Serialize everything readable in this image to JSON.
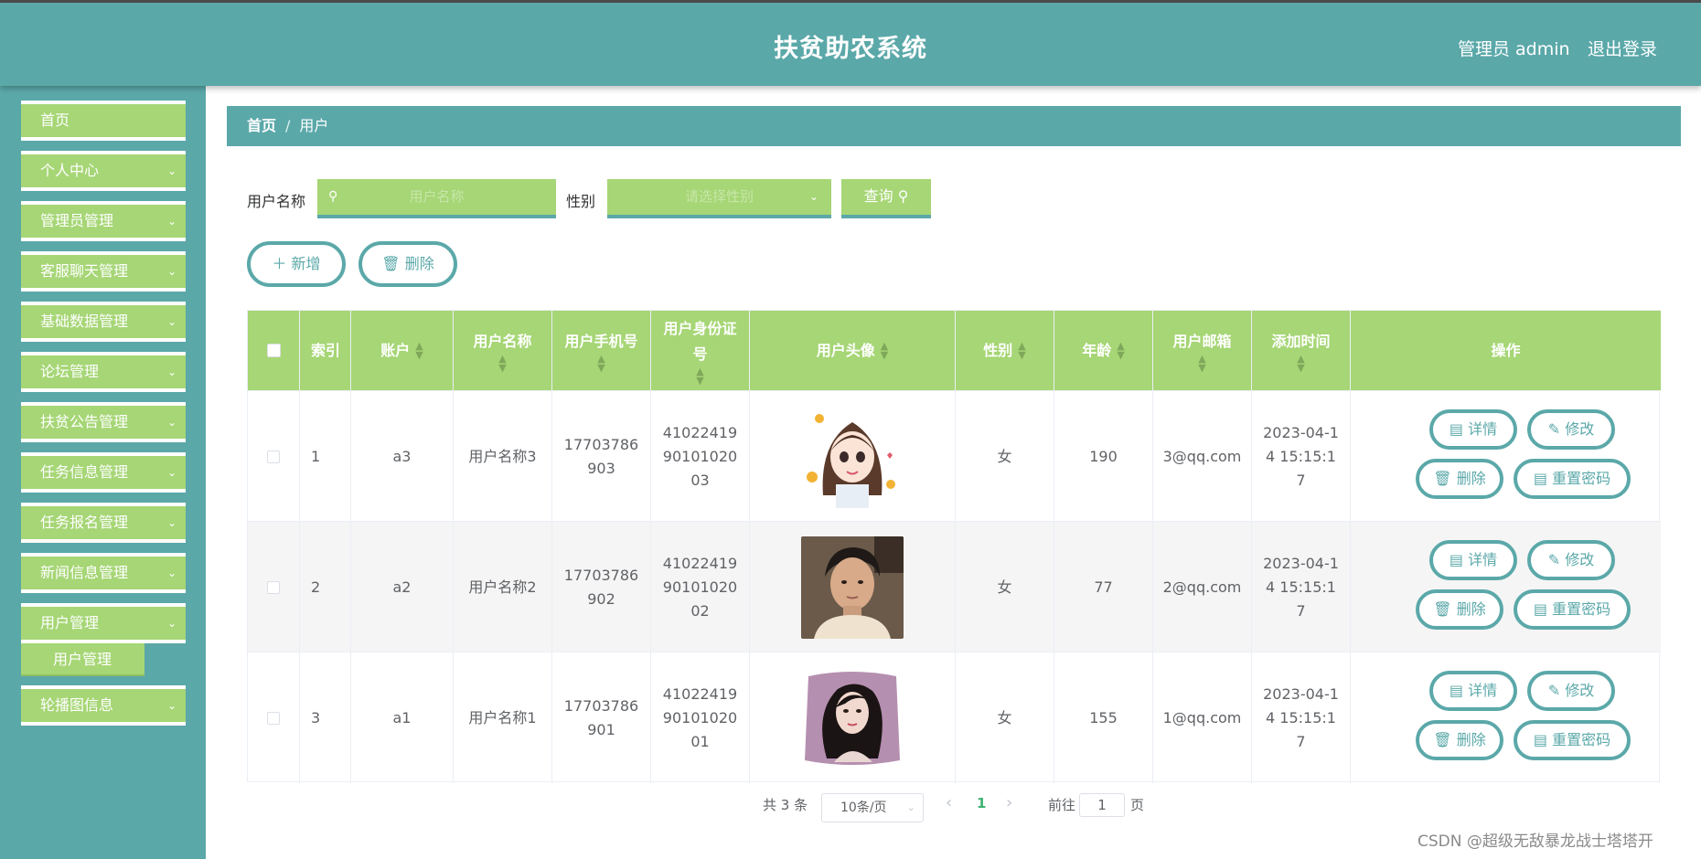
{
  "header": {
    "title": "扶贫助农系统",
    "user": "管理员 admin",
    "logout": "退出登录"
  },
  "sidebar": {
    "items": [
      {
        "label": "首页",
        "expandable": false
      },
      {
        "label": "个人中心",
        "expandable": true
      },
      {
        "label": "管理员管理",
        "expandable": true
      },
      {
        "label": "客服聊天管理",
        "expandable": true
      },
      {
        "label": "基础数据管理",
        "expandable": true
      },
      {
        "label": "论坛管理",
        "expandable": true
      },
      {
        "label": "扶贫公告管理",
        "expandable": true
      },
      {
        "label": "任务信息管理",
        "expandable": true
      },
      {
        "label": "任务报名管理",
        "expandable": true
      },
      {
        "label": "新闻信息管理",
        "expandable": true
      },
      {
        "label": "用户管理",
        "expandable": true,
        "expanded": true,
        "children": [
          "用户管理"
        ]
      },
      {
        "label": "轮播图信息",
        "expandable": true
      }
    ]
  },
  "breadcrumb": {
    "home": "首页",
    "separator": "/",
    "current": "用户"
  },
  "filters": {
    "username_label": "用户名称",
    "username_placeholder": "用户名称",
    "gender_label": "性别",
    "gender_placeholder": "请选择性别",
    "query_button": "查询"
  },
  "actions": {
    "add": "新增",
    "delete": "删除"
  },
  "table": {
    "columns": [
      "索引",
      "账户",
      "用户名称",
      "用户手机号",
      "用户身份证号",
      "用户头像",
      "性别",
      "年龄",
      "用户邮箱",
      "添加时间",
      "操作"
    ],
    "rows": [
      {
        "index": "1",
        "account": "a3",
        "name": "用户名称3",
        "phone": "17703786903",
        "id_card": "410224199010102003",
        "avatar": "cartoon-girl-avatar",
        "gender": "女",
        "age": "190",
        "email": "3@qq.com",
        "created": "2023-04-14 15:15:17"
      },
      {
        "index": "2",
        "account": "a2",
        "name": "用户名称2",
        "phone": "17703786902",
        "id_card": "410224199010102002",
        "avatar": "young-man-photo",
        "gender": "女",
        "age": "77",
        "email": "2@qq.com",
        "created": "2023-04-14 15:15:17"
      },
      {
        "index": "3",
        "account": "a1",
        "name": "用户名称1",
        "phone": "17703786901",
        "id_card": "410224199010102001",
        "avatar": "woman-portrait-pillow",
        "gender": "女",
        "age": "155",
        "email": "1@qq.com",
        "created": "2023-04-14 15:15:17"
      }
    ],
    "row_actions": {
      "detail": "详情",
      "edit": "修改",
      "delete": "删除",
      "reset_password": "重置密码"
    }
  },
  "pagination": {
    "total": "共 3 条",
    "page_size": "10条/页",
    "current_page": "1",
    "goto_label": "前往",
    "goto_value": "1",
    "page_suffix": "页"
  },
  "watermark": "CSDN @超级无敌暴龙战士塔塔开",
  "colors": {
    "teal": "#5ba8a9",
    "green": "#a6d675",
    "link_green": "#3cb371"
  }
}
